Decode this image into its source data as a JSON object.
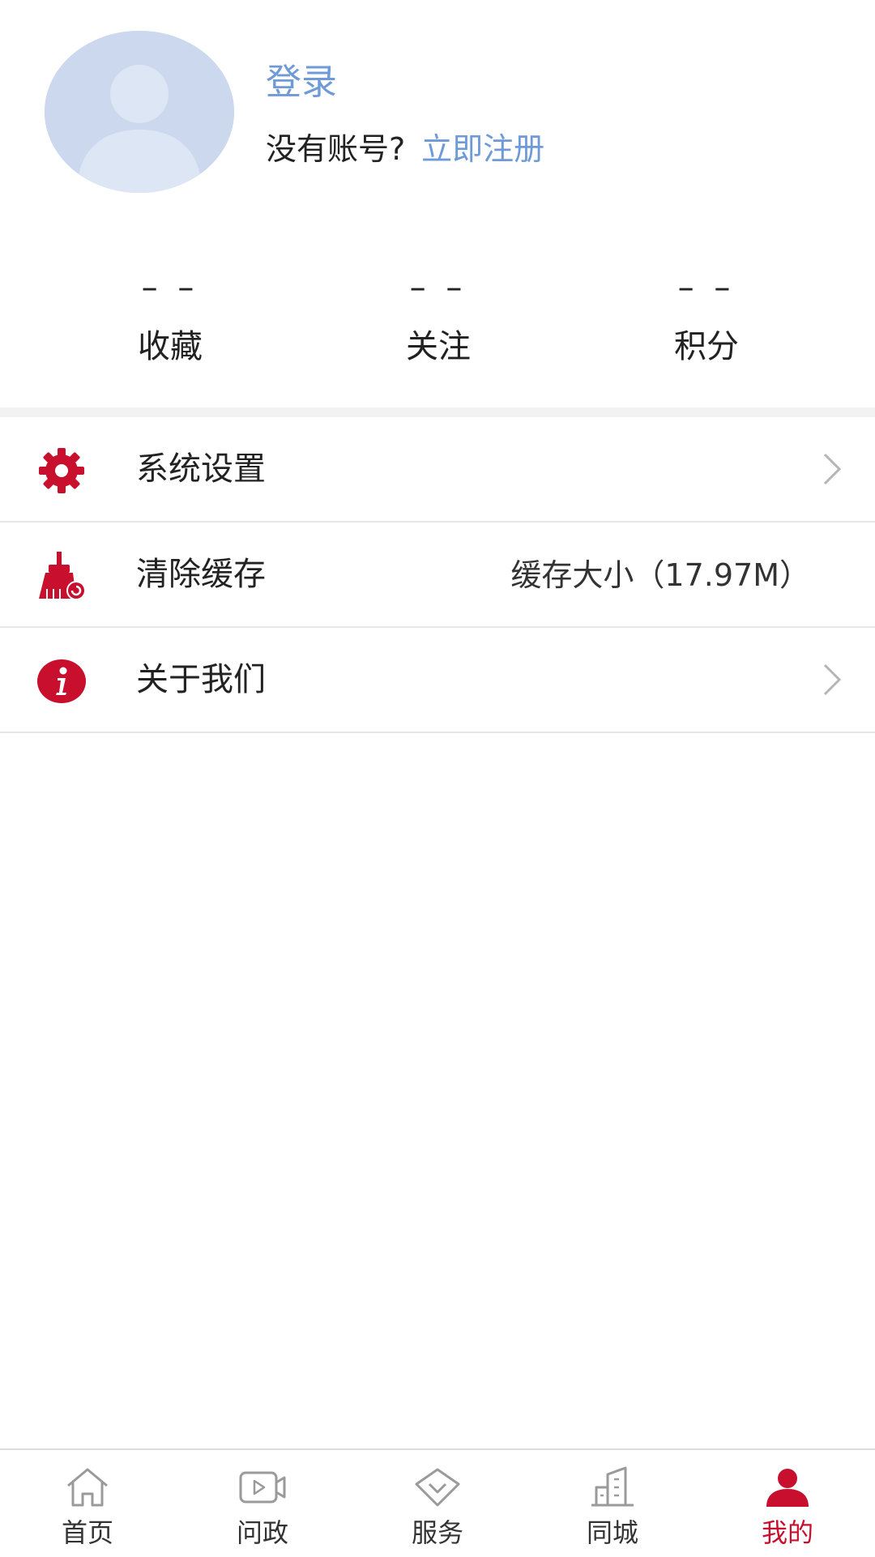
{
  "header": {
    "login_label": "登录",
    "no_account_prompt": "没有账号?",
    "register_label": "立即注册"
  },
  "stats": [
    {
      "value": "– –",
      "label": "收藏"
    },
    {
      "value": "– –",
      "label": "关注"
    },
    {
      "value": "– –",
      "label": "积分"
    }
  ],
  "menu": {
    "settings": {
      "label": "系统设置",
      "icon": "gear-icon"
    },
    "clear_cache": {
      "label": "清除缓存",
      "icon": "broom-icon",
      "cache_size": "缓存大小（17.97M）"
    },
    "about": {
      "label": "关于我们",
      "icon": "info-icon"
    }
  },
  "tabbar": {
    "tabs": [
      {
        "label": "首页",
        "icon": "home-icon"
      },
      {
        "label": "问政",
        "icon": "video-icon"
      },
      {
        "label": "服务",
        "icon": "service-icon"
      },
      {
        "label": "同城",
        "icon": "city-icon"
      },
      {
        "label": "我的",
        "icon": "person-icon",
        "active": true
      }
    ]
  },
  "colors": {
    "accent_red": "#c8102e",
    "link_blue": "#6e9bd8",
    "avatar_bg": "#ccd8ee"
  }
}
